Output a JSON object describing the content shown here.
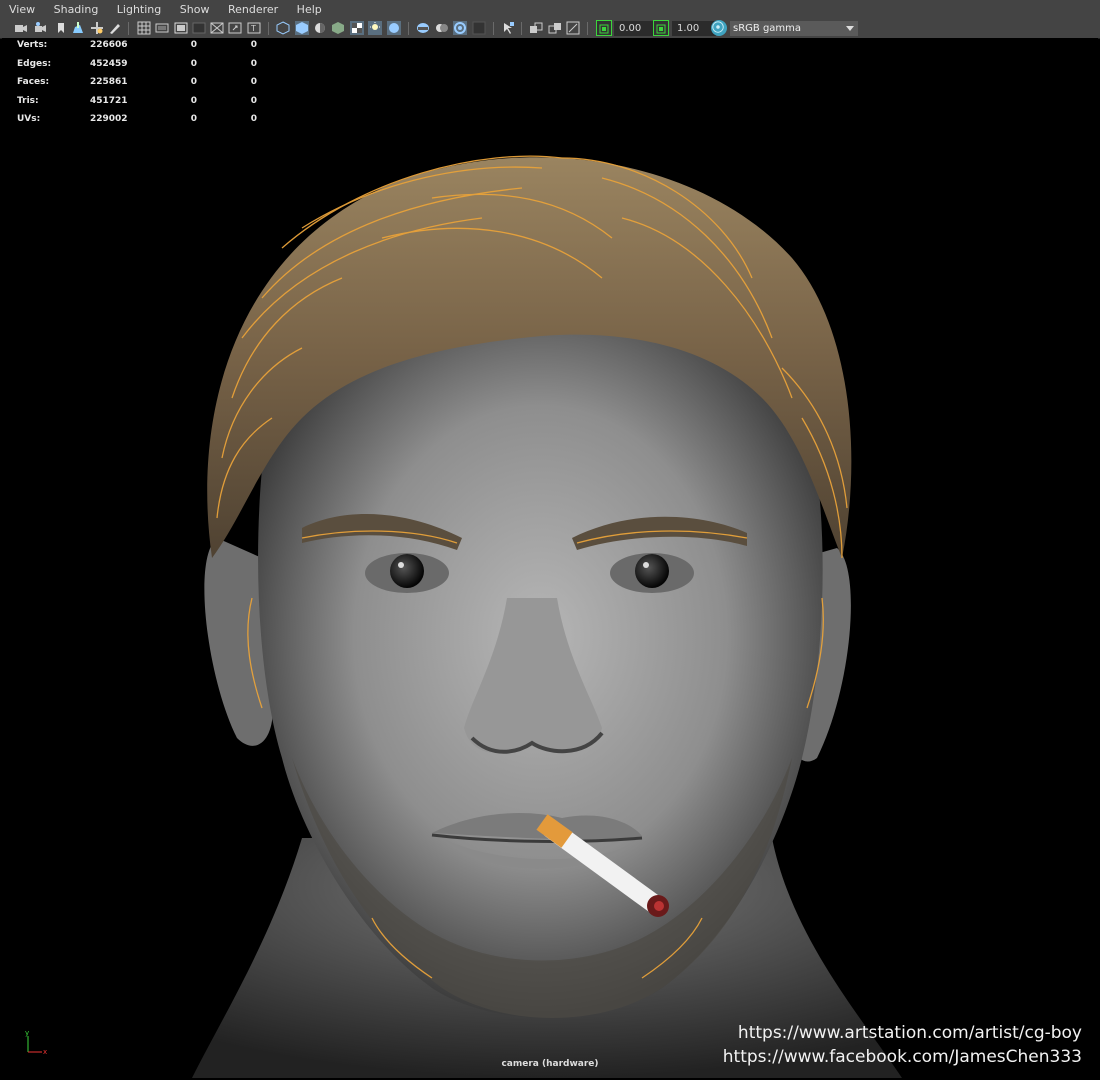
{
  "menu": [
    "View",
    "Shading",
    "Lighting",
    "Show",
    "Renderer",
    "Help"
  ],
  "toolbar": {
    "exposure_value": "0.00",
    "gamma_value": "1.00",
    "color_management": "sRGB gamma",
    "icons": [
      "camera-icon",
      "camera-attributes-icon",
      "bookmark-icon",
      "image-plane-icon",
      "2d-pan-zoom-icon",
      "grease-pencil-icon",
      "grid-icon",
      "film-gate-icon",
      "resolution-gate-icon",
      "gate-mask-icon",
      "field-chart-icon",
      "safe-action-icon",
      "wireframe-icon",
      "smooth-shade-icon",
      "default-material-icon",
      "textured-icon",
      "shadows-icon",
      "use-all-lights-icon",
      "ambient-occlusion-icon",
      "motion-blur-icon",
      "anti-aliasing-icon",
      "depth-of-field-icon",
      "isolate-select-icon",
      "xray-icon",
      "xray-joints-icon",
      "xray-active-icon",
      "exposure-icon",
      "gamma-icon",
      "color-management-icon"
    ]
  },
  "hud": [
    {
      "label": "Verts:",
      "v1": "226606",
      "v2": "0",
      "v3": "0"
    },
    {
      "label": "Edges:",
      "v1": "452459",
      "v2": "0",
      "v3": "0"
    },
    {
      "label": "Faces:",
      "v1": "225861",
      "v2": "0",
      "v3": "0"
    },
    {
      "label": "Tris:",
      "v1": "451721",
      "v2": "0",
      "v3": "0"
    },
    {
      "label": "UVs:",
      "v1": "229002",
      "v2": "0",
      "v3": "0"
    }
  ],
  "viewport": {
    "camera_label": "camera (hardware)",
    "axis_y": "y",
    "axis_x": "x"
  },
  "watermark": {
    "line1": "https://www.artstation.com/artist/cg-boy",
    "line2": "https://www.facebook.com/JamesChen333"
  },
  "colors": {
    "ui_bg": "#444444",
    "viewport_bg": "#000000",
    "accent_green": "#3bd63b",
    "hair_guides": "#e8a23a",
    "skin_grey": "#8e8e8e"
  }
}
